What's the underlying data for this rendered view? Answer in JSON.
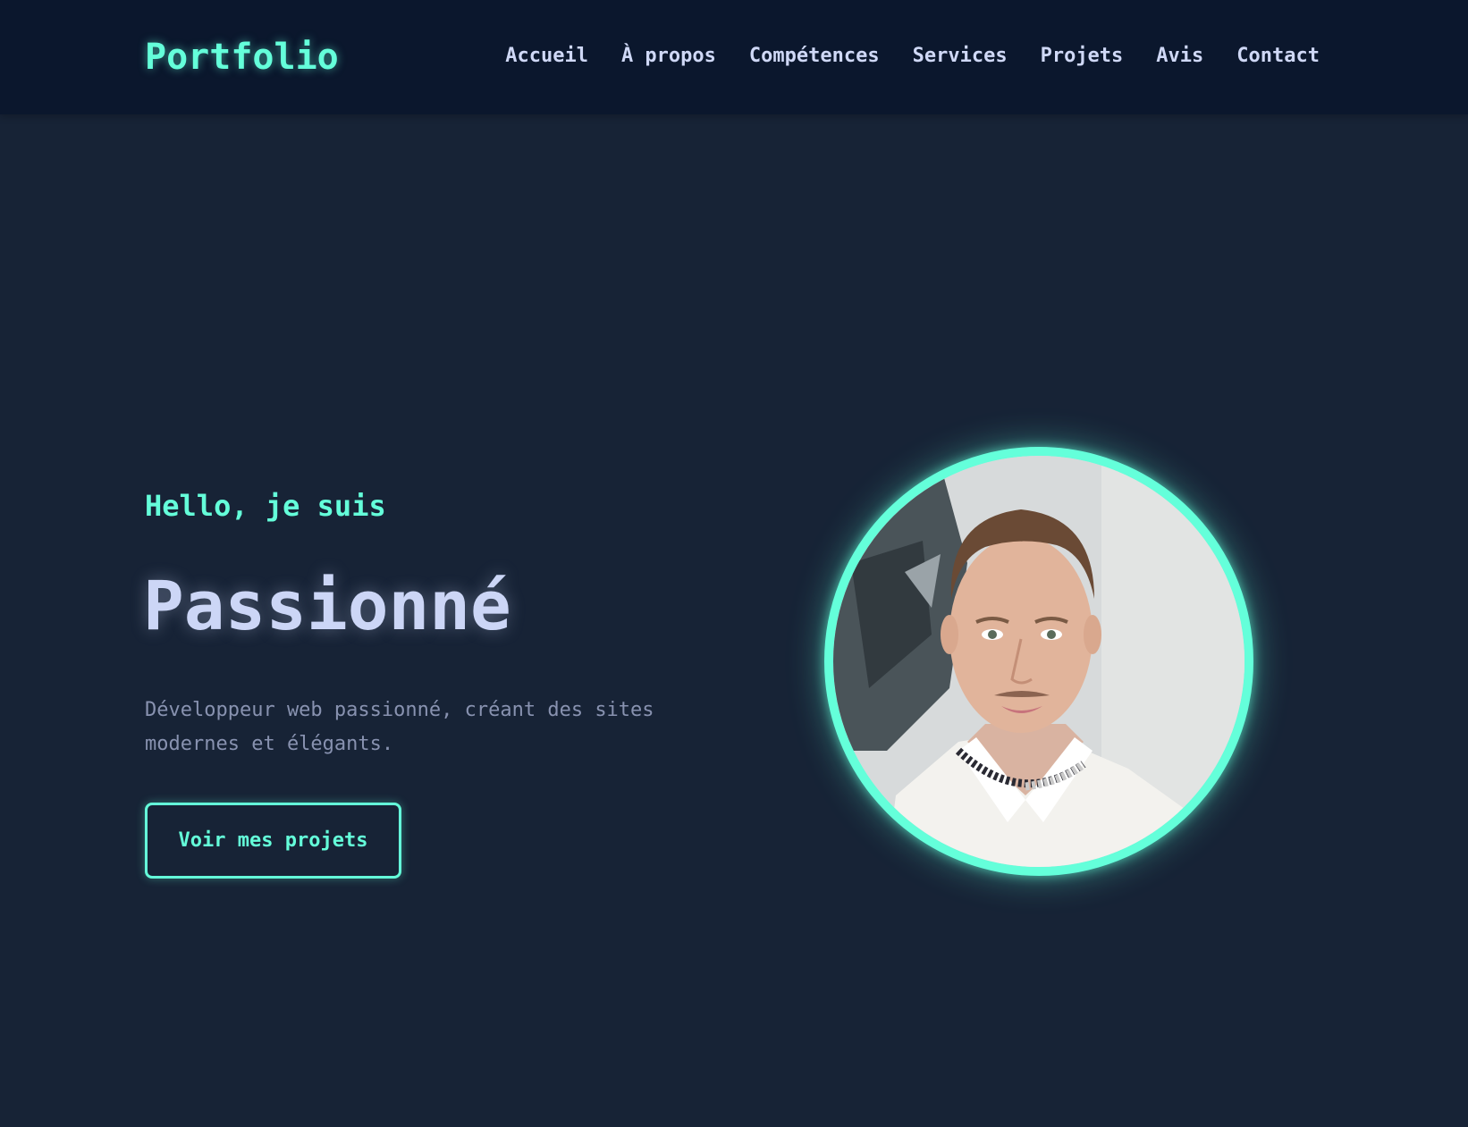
{
  "nav": {
    "logo": "Portfolio",
    "links": [
      {
        "label": "Accueil"
      },
      {
        "label": "À propos"
      },
      {
        "label": "Compétences"
      },
      {
        "label": "Services"
      },
      {
        "label": "Projets"
      },
      {
        "label": "Avis"
      },
      {
        "label": "Contact"
      }
    ]
  },
  "hero": {
    "greeting": "Hello, je suis",
    "title": "Passionné",
    "description": "Développeur web passionné, créant des sites modernes et élégants.",
    "cta_label": "Voir mes projets"
  },
  "colors": {
    "accent": "#64ffda",
    "background": "#172336",
    "navbar": "#0b172d",
    "heading": "#ccd6f6",
    "body_text": "#8892b0"
  }
}
